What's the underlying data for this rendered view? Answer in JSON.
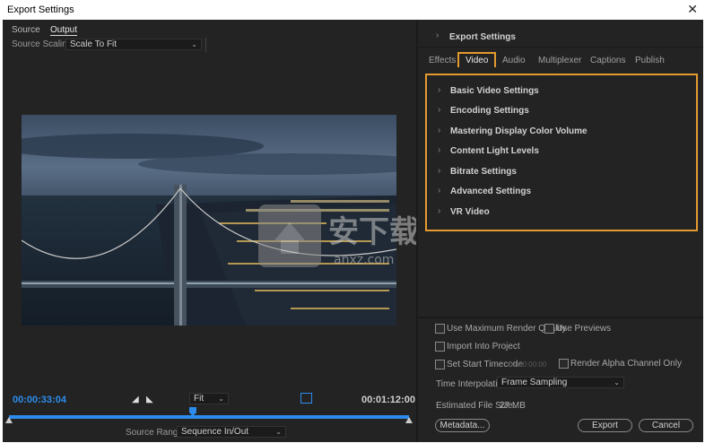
{
  "window": {
    "title": "Export Settings",
    "close_label": "✕"
  },
  "left": {
    "tabs": [
      "Source",
      "Output"
    ],
    "active_tab": "Output",
    "source_scaling_label": "Source Scaling:",
    "source_scaling_value": "Scale To Fit",
    "timecode_current": "00:00:33:04",
    "timecode_total": "00:01:12:00",
    "zoom_value": "Fit",
    "source_range_label": "Source Range:",
    "source_range_value": "Sequence In/Out"
  },
  "right": {
    "export_settings_label": "Export Settings",
    "tabs": [
      "Effects",
      "Video",
      "Audio",
      "Multiplexer",
      "Captions",
      "Publish"
    ],
    "active_tab": "Video",
    "sections": [
      "Basic Video Settings",
      "Encoding Settings",
      "Mastering Display Color Volume",
      "Content Light Levels",
      "Bitrate Settings",
      "Advanced Settings",
      "VR Video"
    ],
    "options": {
      "max_render_quality": "Use Maximum Render Quality",
      "use_previews": "Use Previews",
      "import_into_project": "Import Into Project",
      "set_start_timecode": "Set Start Timecode",
      "start_timecode_value": "00:00:00:00",
      "render_alpha": "Render Alpha Channel Only"
    },
    "time_interpolation_label": "Time Interpolation:",
    "time_interpolation_value": "Frame Sampling",
    "estimated_file_size_label": "Estimated File Size:",
    "estimated_file_size_value": "27 MB",
    "metadata_button": "Metadata...",
    "export_button": "Export",
    "cancel_button": "Cancel"
  },
  "watermark": {
    "text": "安下载",
    "sub": "anxz.com"
  },
  "colors": {
    "accent_blue": "#2d8ceb",
    "highlight_orange": "#e49a2e",
    "panel_bg": "#232323"
  }
}
